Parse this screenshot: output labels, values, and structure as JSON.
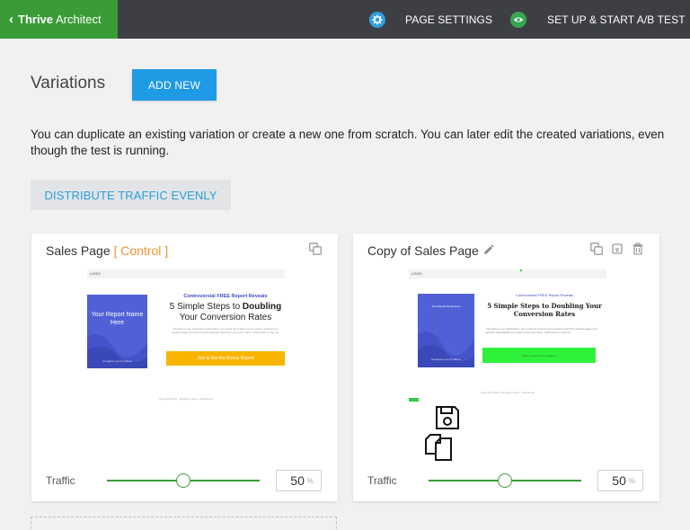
{
  "topbar": {
    "brand_bold": "Thrive",
    "brand_rest": "Architect",
    "page_settings": "PAGE SETTINGS",
    "ab_test": "SET UP & START A/B TEST",
    "brand_color": "#3a9b37",
    "bar_color": "#3d3f45"
  },
  "header": {
    "title": "Variations",
    "add_new": "ADD NEW",
    "description": "You can duplicate an existing variation or create a new one from scratch. You can later edit the created variations, even though the test is running.",
    "distribute": "DISTRIBUTE TRAFFIC EVENLY"
  },
  "variations": [
    {
      "title": "Sales Page",
      "badge": "[ Control ]",
      "traffic_label": "Traffic",
      "traffic_value": "50",
      "traffic_unit": "%",
      "traffic_fraction": 0.5,
      "icons": [
        "duplicate-icon"
      ],
      "preview": {
        "logo": "LOGO",
        "book_title": "Your Report Name Here",
        "book_sub": "brought to you by Name",
        "kicker": "Controversial FREE Report Reveals",
        "headline_a": "5 Simple Steps to ",
        "headline_bold": "Doubling",
        "headline_b": "Your Conversion Rates",
        "body": "Introduce to our respective subscribers, we reveal the 5 steps we've used to optimize our landing pages and achieve dramatically improved conversion rates. Click below to sign up.",
        "button": "Join & Get the Bonus Report",
        "footer": "Copyright 2016, Company Name - Disclaimer"
      }
    },
    {
      "title": "Copy of Sales Page",
      "traffic_label": "Traffic",
      "traffic_value": "50",
      "traffic_unit": "%",
      "traffic_fraction": 0.5,
      "icons": [
        "pencil-icon",
        "duplicate-icon",
        "archive-icon",
        "trash-icon"
      ],
      "preview": {
        "logo": "LOGO",
        "book_title": "Your Report Name Here",
        "book_sub": "brought to you by Name",
        "kicker": "Controversial FREE Report Reveals",
        "headline": "5 Simple Steps to Doubling Your Conversion Rates",
        "body": "Introduce to our subscribers, we reveal the 5 steps we've used to optimize landing pages and achieve dramatically improved conversion rates. Click below to sign up.",
        "button": "Click to Get the Free Report",
        "footer": "Copyright 2016, Company Name - Disclaimer"
      }
    }
  ],
  "colors": {
    "accent_blue": "#1e9be4",
    "control_orange": "#f0932b",
    "slider_green": "#3d9a36"
  }
}
